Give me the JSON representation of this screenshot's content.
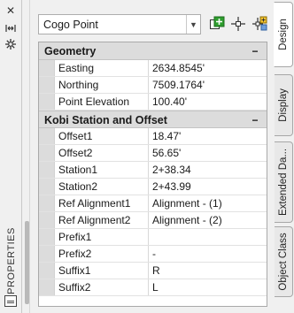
{
  "palette": {
    "title": "PROPERTIES",
    "buttons": [
      "close-icon",
      "auto-hide-icon",
      "settings-icon"
    ]
  },
  "selector": {
    "value": "Cogo Point"
  },
  "toolbar": {
    "icons": [
      "add-to-selection-icon",
      "quick-select-icon",
      "toggle-pickadd-icon"
    ]
  },
  "sections": [
    {
      "title": "Geometry",
      "collapse": "−",
      "rows": [
        {
          "name": "Easting",
          "value": "2634.8545'"
        },
        {
          "name": "Northing",
          "value": "7509.1764'"
        },
        {
          "name": "Point Elevation",
          "value": "100.40'"
        }
      ]
    },
    {
      "title": "Kobi Station and Offset",
      "collapse": "−",
      "rows": [
        {
          "name": "Offset1",
          "value": "18.47'"
        },
        {
          "name": "Offset2",
          "value": "56.65'"
        },
        {
          "name": "Station1",
          "value": "2+38.34"
        },
        {
          "name": "Station2",
          "value": "2+43.99"
        },
        {
          "name": "Ref Alignment1",
          "value": "Alignment - (1)"
        },
        {
          "name": "Ref Alignment2",
          "value": "Alignment - (2)"
        },
        {
          "name": "Prefix1",
          "value": ""
        },
        {
          "name": "Prefix2",
          "value": "-"
        },
        {
          "name": "Suffix1",
          "value": "R"
        },
        {
          "name": "Suffix2",
          "value": "L"
        }
      ]
    }
  ],
  "tabs": [
    {
      "label": "Design",
      "active": true
    },
    {
      "label": "Display",
      "active": false
    },
    {
      "label": "Extended Da...",
      "active": false
    },
    {
      "label": "Object Class",
      "active": false
    }
  ],
  "colors": {
    "accent_green": "#2e9e2e",
    "section_bg": "#dcdcdc",
    "panel_bg": "#f0f0f0"
  }
}
